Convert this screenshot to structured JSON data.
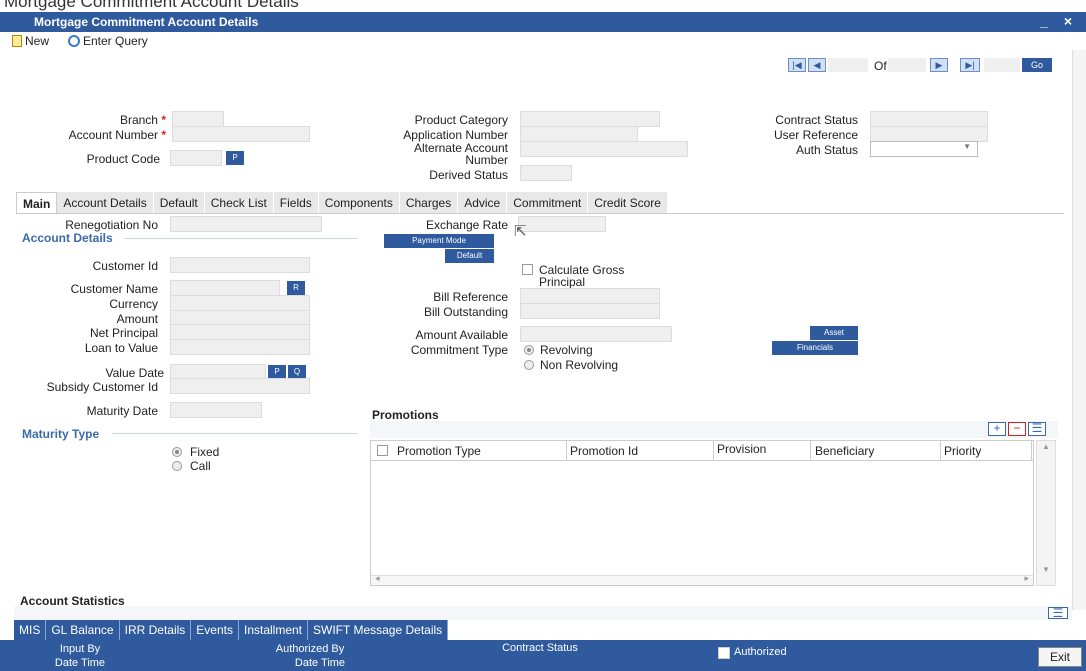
{
  "top_strip": "Mortgage Commitment Account Details",
  "title": "Mortgage Commitment Account Details",
  "window_controls": "_ ×",
  "toolbar": {
    "new": "New",
    "enter_query": "Enter Query"
  },
  "nav": {
    "of": "Of",
    "go": "Go",
    "first": "|◀",
    "prev": "◀",
    "next": "▶",
    "last": "▶|"
  },
  "header": {
    "branch": "Branch",
    "account_number": "Account Number",
    "product_code": "Product Code",
    "p_btn": "P",
    "product_category": "Product Category",
    "application_number": "Application Number",
    "alternate_account_number": "Alternate Account Number",
    "derived_status": "Derived Status",
    "contract_status": "Contract Status",
    "user_reference": "User Reference",
    "auth_status": "Auth Status"
  },
  "tabs": [
    "Main",
    "Account Details",
    "Default",
    "Check List",
    "Fields",
    "Components",
    "Charges",
    "Advice",
    "Commitment",
    "Credit Score"
  ],
  "main": {
    "renegotiation_no": "Renegotiation No",
    "account_details_hdr": "Account Details",
    "customer_id": "Customer Id",
    "customer_name": "Customer Name",
    "r_btn": "R",
    "currency": "Currency",
    "amount": "Amount",
    "net_principal": "Net Principal",
    "loan_to_value": "Loan to Value",
    "value_date": "Value Date",
    "p_btn": "P",
    "q_btn": "Q",
    "subsidy_customer_id": "Subsidy Customer Id",
    "maturity_date": "Maturity Date",
    "maturity_type_hdr": "Maturity Type",
    "fixed": "Fixed",
    "call": "Call",
    "exchange_rate": "Exchange Rate",
    "payment_mode": "Payment Mode",
    "default_btn": "Default",
    "calc_gross_1": "Calculate Gross",
    "calc_gross_2": "Principal",
    "bill_reference": "Bill Reference",
    "bill_outstanding": "Bill Outstanding",
    "amount_available": "Amount Available",
    "asset": "Asset",
    "financials": "Financials",
    "commitment_type": "Commitment Type",
    "revolving": "Revolving",
    "non_revolving": "Non Revolving"
  },
  "promotions": {
    "title": "Promotions",
    "columns": [
      "Promotion Type",
      "Promotion Id",
      "Provision",
      "Beneficiary",
      "Priority"
    ]
  },
  "account_statistics": "Account Statistics",
  "bottom_tabs": [
    "MIS",
    "GL Balance",
    "IRR Details",
    "Events",
    "Installment",
    "SWIFT Message Details"
  ],
  "footer": {
    "input_by": "Input By",
    "date_time_1": "Date Time",
    "authorized_by": "Authorized By",
    "date_time_2": "Date Time",
    "contract_status": "Contract Status",
    "authorized": "Authorized",
    "exit": "Exit"
  },
  "colors": {
    "titlebar": "#2f5a9e",
    "section": "#3b6aa8"
  }
}
